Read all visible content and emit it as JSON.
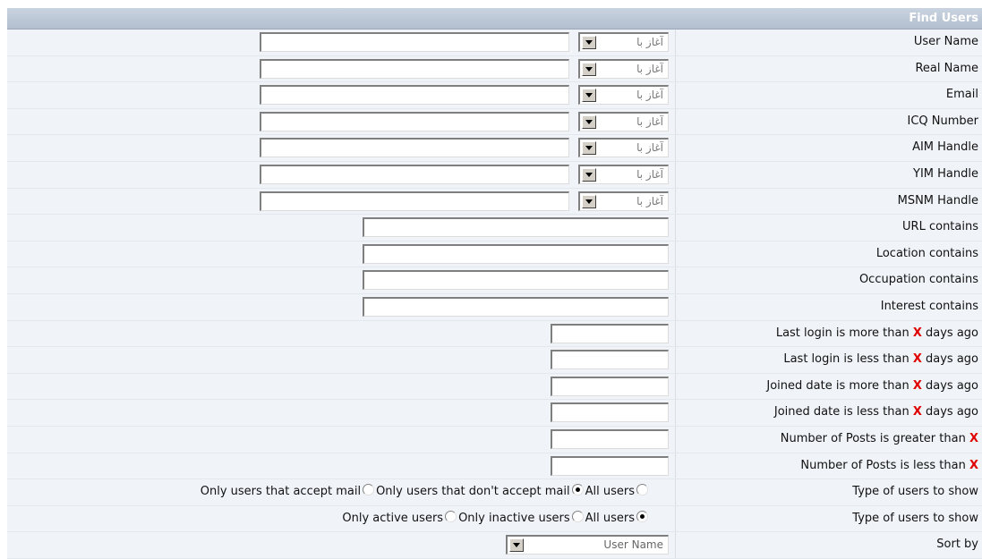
{
  "header": {
    "title": "Find Users"
  },
  "select_default": "آغاز با",
  "rows_select": [
    {
      "label": "User Name"
    },
    {
      "label": "Real Name"
    },
    {
      "label": "Email"
    },
    {
      "label": "ICQ Number"
    },
    {
      "label": "AIM Handle"
    },
    {
      "label": "YIM Handle"
    },
    {
      "label": "MSNM Handle"
    }
  ],
  "rows_contains": [
    {
      "label": "URL contains"
    },
    {
      "label": "Location contains"
    },
    {
      "label": "Occupation contains"
    },
    {
      "label": "Interest contains"
    }
  ],
  "rows_days": [
    {
      "before": "Last login is more than ",
      "x": "X",
      "after": " days ago"
    },
    {
      "before": "Last login is less than ",
      "x": "X",
      "after": " days ago"
    },
    {
      "before": "Joined date is more than ",
      "x": "X",
      "after": " days ago"
    },
    {
      "before": "Joined date is less than ",
      "x": "X",
      "after": " days ago"
    },
    {
      "before": "Number of Posts is greater than ",
      "x": "X",
      "after": ""
    },
    {
      "before": "Number of Posts is less than ",
      "x": "X",
      "after": ""
    }
  ],
  "mail_filter": {
    "label": "Type of users to show",
    "options": [
      "Only users that accept mail",
      "Only users that don't accept mail",
      "All users"
    ],
    "selected": 2
  },
  "active_filter": {
    "label": "Type of users to show",
    "options": [
      "Only active users",
      "Only inactive users",
      "All users"
    ],
    "selected": 2
  },
  "sort": {
    "label": "Sort by",
    "value": "User Name"
  }
}
